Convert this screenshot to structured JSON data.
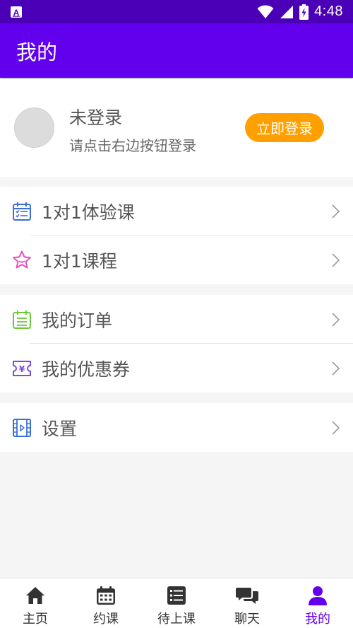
{
  "status_bar": {
    "time": "4:48"
  },
  "app_bar": {
    "title": "我的"
  },
  "profile": {
    "name": "未登录",
    "hint": "请点击右边按钮登录",
    "login_button": "立即登录"
  },
  "menu_groups": [
    {
      "items": [
        {
          "label": "1对1体验课",
          "icon": "calendar-list-icon",
          "icon_color": "#3a6fd8"
        },
        {
          "label": "1对1课程",
          "icon": "star-icon",
          "icon_color": "#e84fbf"
        }
      ]
    },
    {
      "items": [
        {
          "label": "我的订单",
          "icon": "order-calendar-icon",
          "icon_color": "#6cc93a"
        },
        {
          "label": "我的优惠券",
          "icon": "coupon-icon",
          "icon_color": "#7d4bd8"
        }
      ]
    },
    {
      "items": [
        {
          "label": "设置",
          "icon": "film-icon",
          "icon_color": "#3a6fd8"
        }
      ]
    }
  ],
  "bottom_nav": [
    {
      "label": "主页",
      "icon": "home-icon"
    },
    {
      "label": "约课",
      "icon": "calendar-icon"
    },
    {
      "label": "待上课",
      "icon": "list-icon"
    },
    {
      "label": "聊天",
      "icon": "chat-icon"
    },
    {
      "label": "我的",
      "icon": "person-icon",
      "active": true
    }
  ],
  "colors": {
    "primary": "#6200ee",
    "status_bar": "#4b00b8",
    "accent": "#ffa000"
  }
}
